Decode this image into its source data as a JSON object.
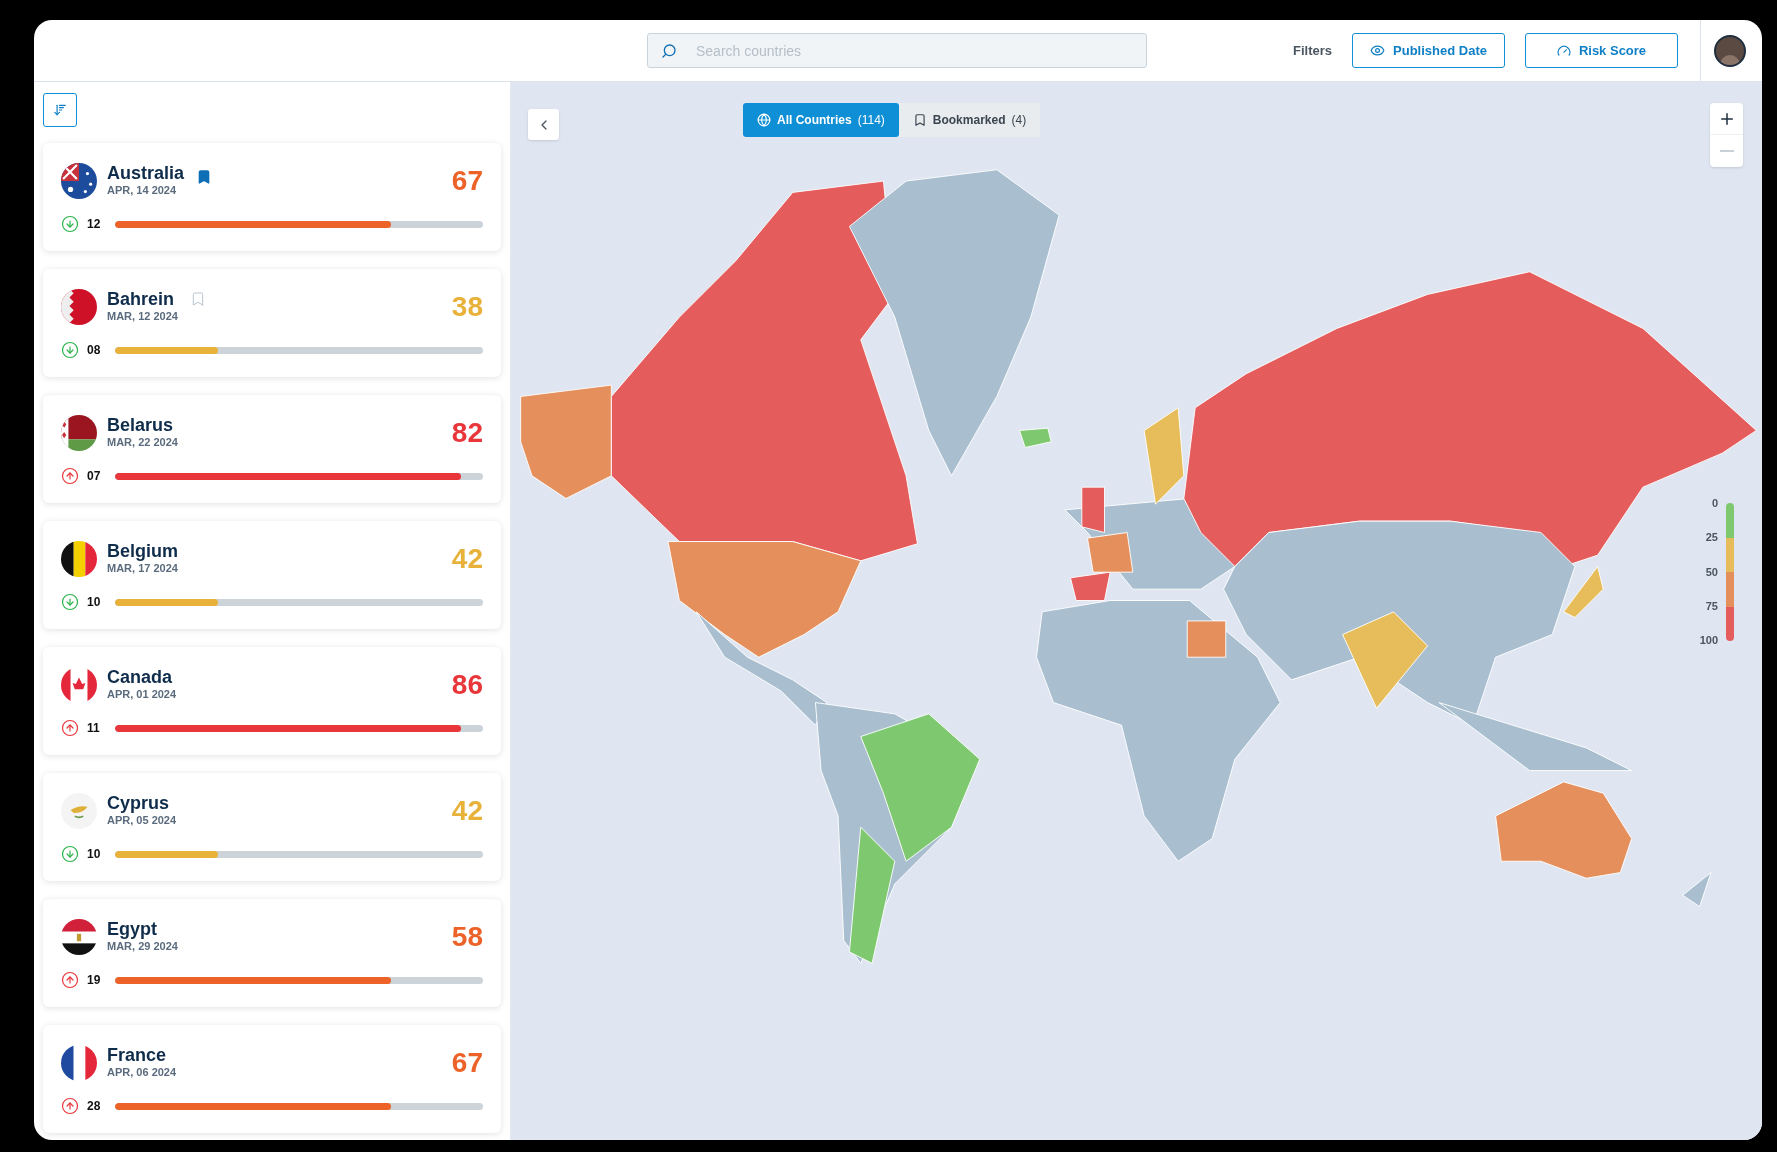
{
  "header": {
    "search": {
      "placeholder": "Search countries"
    },
    "filters_label": "Filters",
    "buttons": [
      {
        "label": "Published Date",
        "kind": "eye"
      },
      {
        "label": "Risk Score",
        "kind": "gauge"
      }
    ]
  },
  "map_tabs": [
    {
      "label": "All Countries",
      "count": "(114)",
      "selected": true
    },
    {
      "label": "Bookmarked",
      "count": "(4)",
      "selected": false
    }
  ],
  "zoom": {
    "out_disabled": true
  },
  "countries": [
    {
      "name": "Australia",
      "date": "APR, 14 2024",
      "bookmarked": true,
      "score": "67",
      "color": "#ec6228",
      "kind": "down",
      "change": "12",
      "level": 0.75
    },
    {
      "name": "Bahrein",
      "date": "MAR, 12 2024",
      "bookmarked": false,
      "score": "38",
      "color": "#e8b23a",
      "kind": "down",
      "change": "08",
      "level": 0.28
    },
    {
      "name": "Belarus",
      "date": "MAR, 22 2024",
      "score": "82",
      "color": "#e8363a",
      "kind": "up",
      "change": "07",
      "level": 0.94
    },
    {
      "name": "Belgium",
      "date": "MAR, 17 2024",
      "score": "42",
      "color": "#e8b23a",
      "kind": "down",
      "change": "10",
      "level": 0.28
    },
    {
      "name": "Canada",
      "date": "APR, 01 2024",
      "score": "86",
      "color": "#e8363a",
      "kind": "up",
      "change": "11",
      "level": 0.94
    },
    {
      "name": "Cyprus",
      "date": "APR, 05 2024",
      "score": "42",
      "color": "#e8b23a",
      "kind": "down",
      "change": "10",
      "level": 0.28
    },
    {
      "name": "Egypt",
      "date": "MAR, 29 2024",
      "score": "58",
      "color": "#ec6228",
      "kind": "up",
      "change": "19",
      "level": 0.75
    },
    {
      "name": "France",
      "date": "APR, 06 2024",
      "score": "67",
      "color": "#ec6228",
      "kind": "up",
      "change": "28",
      "level": 0.75
    }
  ],
  "legend": {
    "labels": [
      "0",
      "25",
      "50",
      "75",
      "100"
    ],
    "segments": [
      {
        "color": "#7ec86f"
      },
      {
        "color": "#e6bd5a"
      },
      {
        "color": "#e58f5c"
      },
      {
        "color": "#e55c5c"
      }
    ]
  }
}
